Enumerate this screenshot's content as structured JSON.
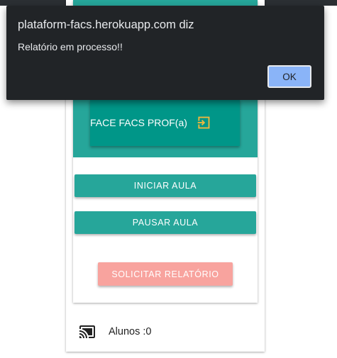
{
  "dialog": {
    "title": "plataform-facs.herokuapp.com diz",
    "message": "Relatório em processo!!",
    "ok_label": "OK"
  },
  "app": {
    "title": "FACE FACS PROF(a)",
    "start_class_label": "INICIAR AULA",
    "pause_class_label": "PAUSAR AULA",
    "request_report_label": "SOLICITAR RELATÓRIO",
    "students_label": "Alunos :0"
  },
  "colors": {
    "teal_header": "#26a69a",
    "teal_card": "#009688",
    "report_button": "#f8a39e",
    "icon_accent": "#f2b83b",
    "dialog_bg": "#212427",
    "dialog_button": "#8ab4f8"
  },
  "icons": {
    "title": "login-icon",
    "footer": "cast-icon"
  }
}
